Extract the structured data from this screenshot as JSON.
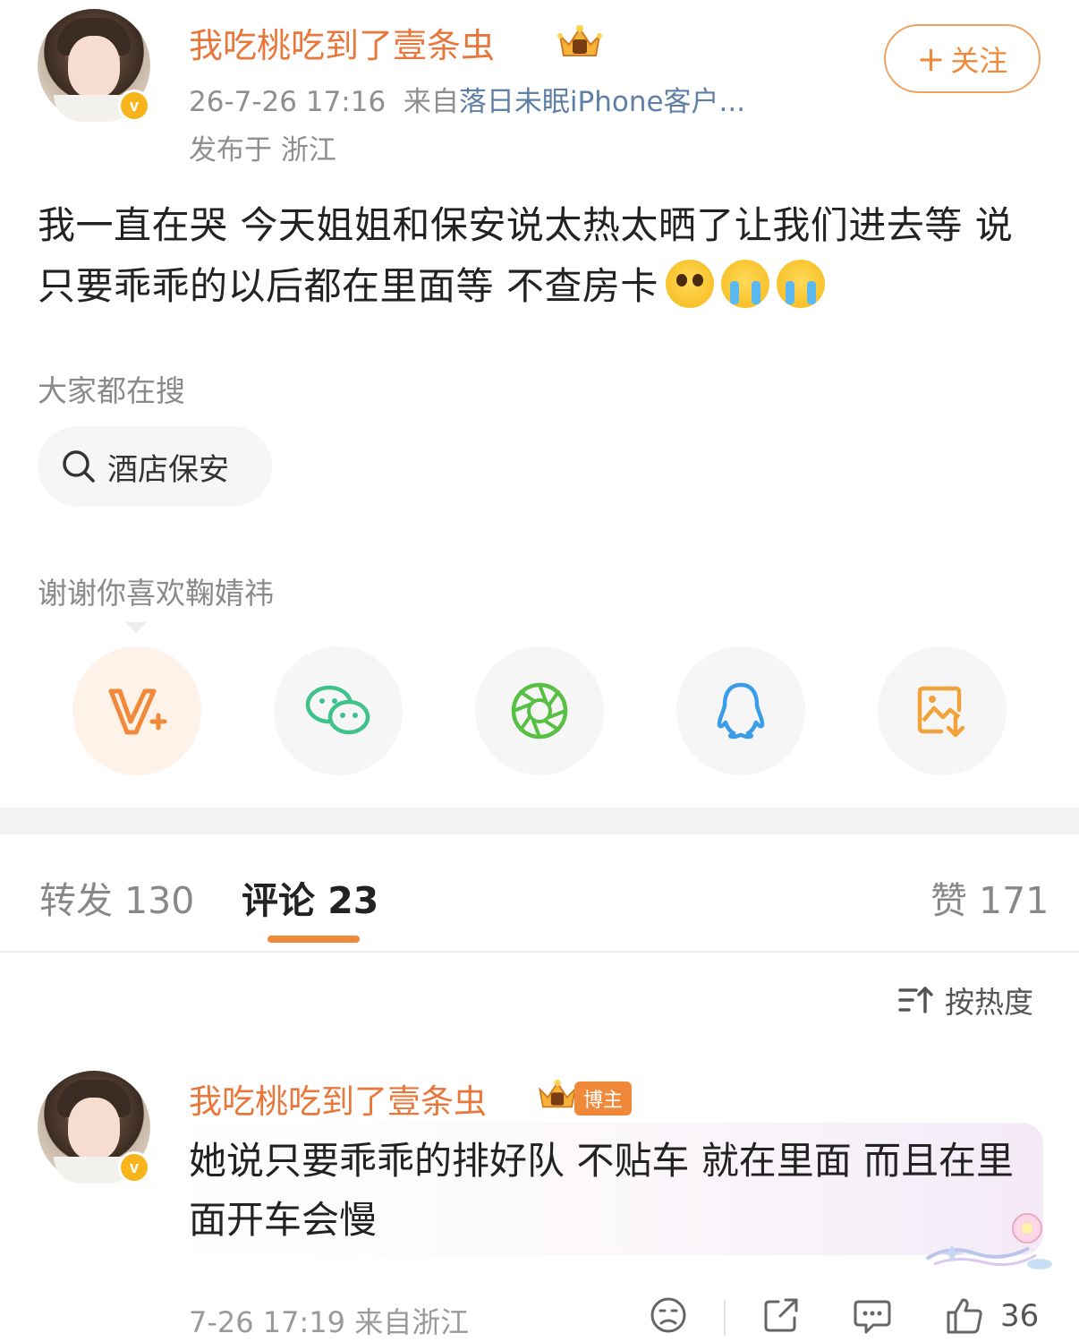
{
  "post": {
    "author": "我吃桃吃到了壹条虫",
    "verified_mark": "v",
    "date": "26-7-26 17:16",
    "source_prefix": "来自",
    "source_app": "落日未眠iPhone客户...",
    "location": "发布于 浙江",
    "follow_label": "关注",
    "text": "我一直在哭 今天姐姐和保安说太热太晒了让我们进去等 说只要乖乖的以后都在里面等 不查房卡"
  },
  "search": {
    "section_title": "大家都在搜",
    "chip_label": "酒店保安"
  },
  "share": {
    "hint": "谢谢你喜欢鞠婧祎",
    "items": [
      "weibo-v-plus-icon",
      "wechat-icon",
      "moments-icon",
      "qq-icon",
      "save-image-icon"
    ]
  },
  "tabs": {
    "repost": "转发 130",
    "comments": "评论 23",
    "likes": "赞 171"
  },
  "sort": {
    "label": "按热度"
  },
  "comment": {
    "author": "我吃桃吃到了壹条虫",
    "verified_mark": "v",
    "tag": "博主",
    "text": "她说只要乖乖的排好队 不贴车 就在里面 而且在里面开车会慢",
    "time": "7-26 17:19",
    "location": "来自浙江",
    "likes": "36"
  },
  "colors": {
    "accent": "#f08a3a",
    "username": "#e8773b",
    "link": "#5f7fa6",
    "wechat": "#3fc28b",
    "moments": "#57c043",
    "qq": "#3a9de8",
    "save": "#f2a23a"
  }
}
